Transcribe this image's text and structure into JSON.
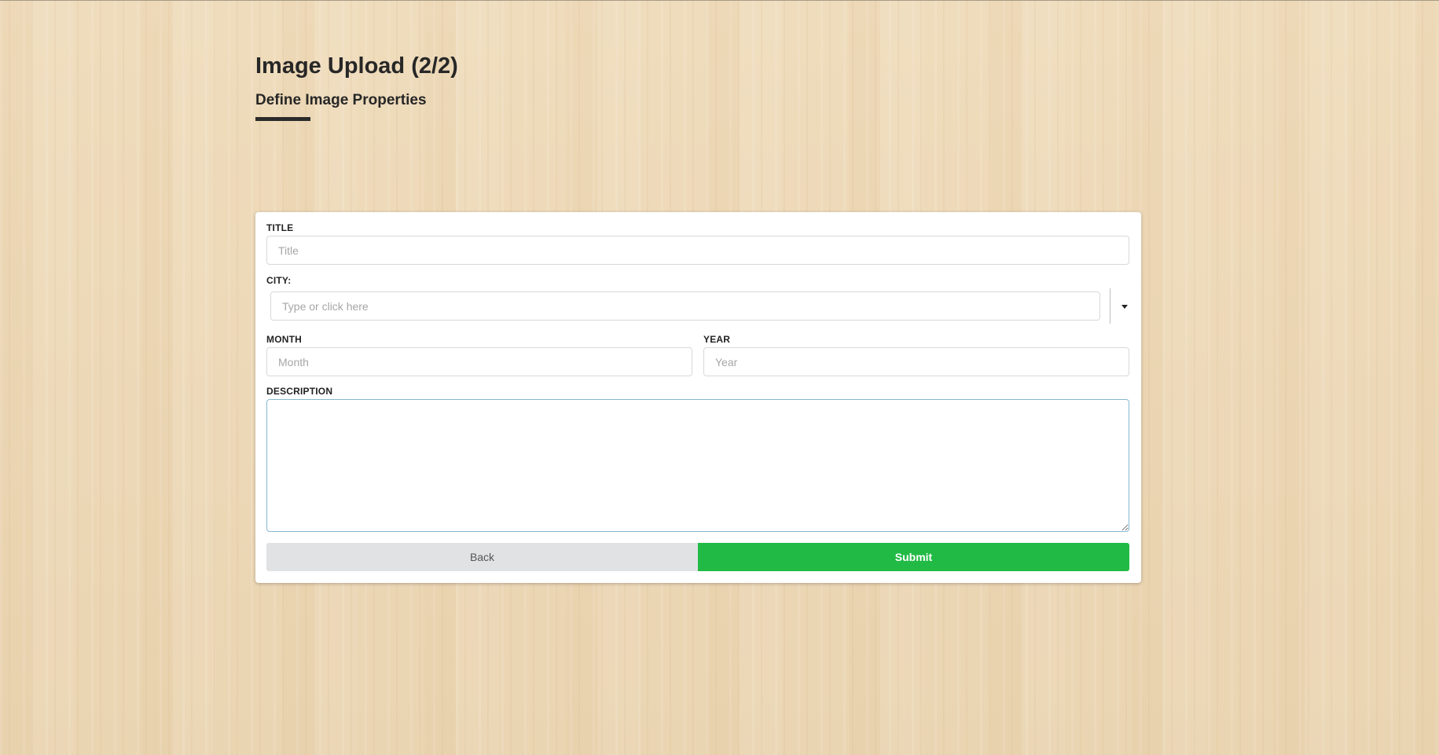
{
  "page": {
    "title": "Image Upload (2/2)",
    "subtitle": "Define Image Properties"
  },
  "form": {
    "title_field": {
      "label": "TITLE",
      "placeholder": "Title",
      "value": ""
    },
    "city_field": {
      "label": "CITY:",
      "placeholder": "Type or click here",
      "value": ""
    },
    "month_field": {
      "label": "MONTH",
      "placeholder": "Month",
      "value": ""
    },
    "year_field": {
      "label": "YEAR",
      "placeholder": "Year",
      "value": ""
    },
    "description_field": {
      "label": "DESCRIPTION",
      "value": ""
    },
    "back_label": "Back",
    "submit_label": "Submit"
  },
  "colors": {
    "submit": "#21ba45",
    "back": "#e1e2e4",
    "focus_border": "#86b7d1"
  },
  "icons": {
    "city_dropdown": "caret-down-icon"
  }
}
